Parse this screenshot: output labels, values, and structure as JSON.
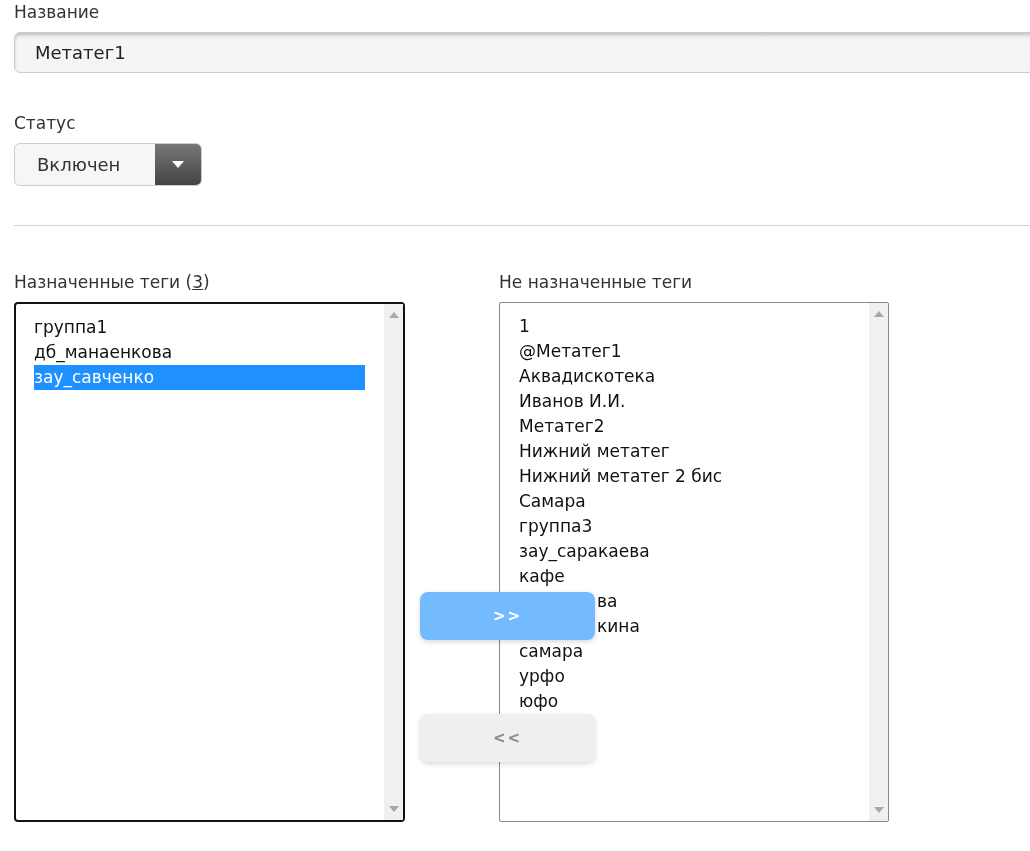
{
  "name_field": {
    "label": "Название",
    "value": "Метатег1"
  },
  "status": {
    "label": "Статус",
    "value": "Включен"
  },
  "assigned": {
    "title_prefix": "Назначенные теги (",
    "count": "3",
    "title_suffix": ")",
    "items": [
      {
        "label": "группа1",
        "selected": false
      },
      {
        "label": "дб_манаенкова",
        "selected": false
      },
      {
        "label": "зау_савченко",
        "selected": true
      }
    ]
  },
  "unassigned": {
    "title": "Не назначенные теги",
    "items": [
      {
        "label": "1",
        "kind": "full"
      },
      {
        "label": "@Метатег1",
        "kind": "full"
      },
      {
        "label": "Аквадискотека",
        "kind": "full"
      },
      {
        "label": "Иванов И.И.",
        "kind": "full"
      },
      {
        "label": "Метатег2",
        "kind": "full"
      },
      {
        "label": "Нижний метатег",
        "kind": "full"
      },
      {
        "label": "Нижний метатег 2 бис",
        "kind": "full"
      },
      {
        "label": "Самара",
        "kind": "full"
      },
      {
        "label": "группа3",
        "kind": "full"
      },
      {
        "label": "зау_саракаева",
        "kind": "full"
      },
      {
        "label": "кафе",
        "kind": "full"
      },
      {
        "label": "ва",
        "kind": "partial"
      },
      {
        "label": "кина",
        "kind": "partial"
      },
      {
        "label": "самара",
        "kind": "full"
      },
      {
        "label": "урфо",
        "kind": "full"
      },
      {
        "label": "юфо",
        "kind": "full"
      }
    ]
  },
  "buttons": [
    {
      "label": ">>",
      "disabled": false
    },
    {
      "label": "<<",
      "disabled": true
    }
  ]
}
